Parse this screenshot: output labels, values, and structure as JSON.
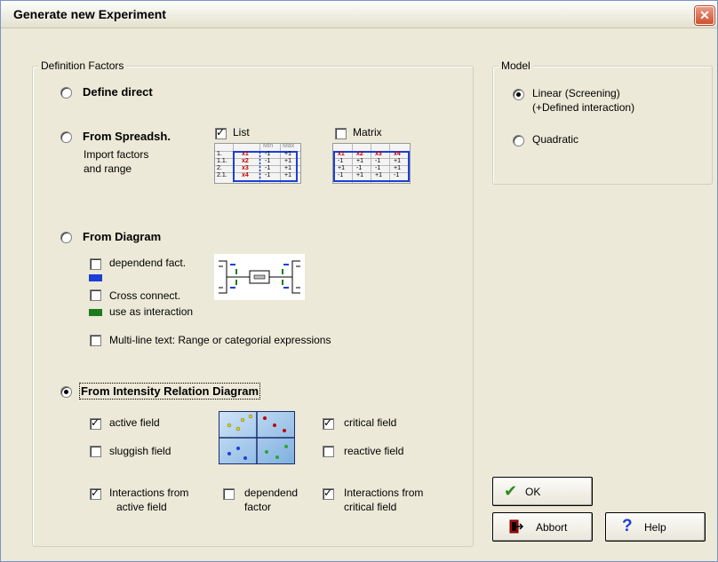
{
  "window": {
    "title": "Generate new Experiment",
    "close_glyph": "✕"
  },
  "definition": {
    "legend": "Definition Factors",
    "define_direct": "Define direct",
    "from_spreadsheet": {
      "label": "From Spreadsh.",
      "desc_line1": "Import factors",
      "desc_line2": "and range",
      "list_label": "List",
      "matrix_label": "Matrix",
      "list_table": {
        "headers": [
          "",
          "",
          "Min",
          "Max"
        ],
        "rows": [
          [
            "1.",
            "x1",
            "-1",
            "+1"
          ],
          [
            "1.1.",
            "x2",
            "-1",
            "+1"
          ],
          [
            "2.",
            "x3",
            "-1",
            "+1"
          ],
          [
            "2.1.",
            "x4",
            "-1",
            "+1"
          ]
        ]
      },
      "matrix_table": {
        "rows": [
          [
            "x1",
            "x2",
            "x3",
            "x4"
          ],
          [
            "-1",
            "+1",
            "-1",
            "+1"
          ],
          [
            "+1",
            "-1",
            "-1",
            "+1"
          ],
          [
            "-1",
            "+1",
            "+1",
            "-1"
          ]
        ]
      }
    },
    "from_diagram": {
      "label": "From Diagram",
      "dependend": "dependend fact.",
      "cross_connect": "Cross connect.",
      "use_as_interaction": "use as interaction",
      "multiline": "Multi-line text: Range or categorial expressions"
    },
    "from_intensity": {
      "label": "From Intensity Relation Diagram",
      "active_field": "active field",
      "sluggish_field": "sluggish field",
      "critical_field": "critical field",
      "reactive_field": "reactive field",
      "interactions_active_1": "Interactions from",
      "interactions_active_2": "active field",
      "dependend_1": "dependend",
      "dependend_2": "factor",
      "interactions_critical_1": "Interactions from",
      "interactions_critical_2": "critical field"
    }
  },
  "model": {
    "legend": "Model",
    "linear_1": "Linear (Screening)",
    "linear_2": "(+Defined interaction)",
    "quadratic": "Quadratic"
  },
  "buttons": {
    "ok": "OK",
    "abort": "Abbort",
    "help": "Help"
  },
  "colors": {
    "blue_bar": "#1c3fd6",
    "green_bar": "#1e7a1e",
    "title_close": "#d0512f",
    "ok_check": "#2e8b1e"
  }
}
